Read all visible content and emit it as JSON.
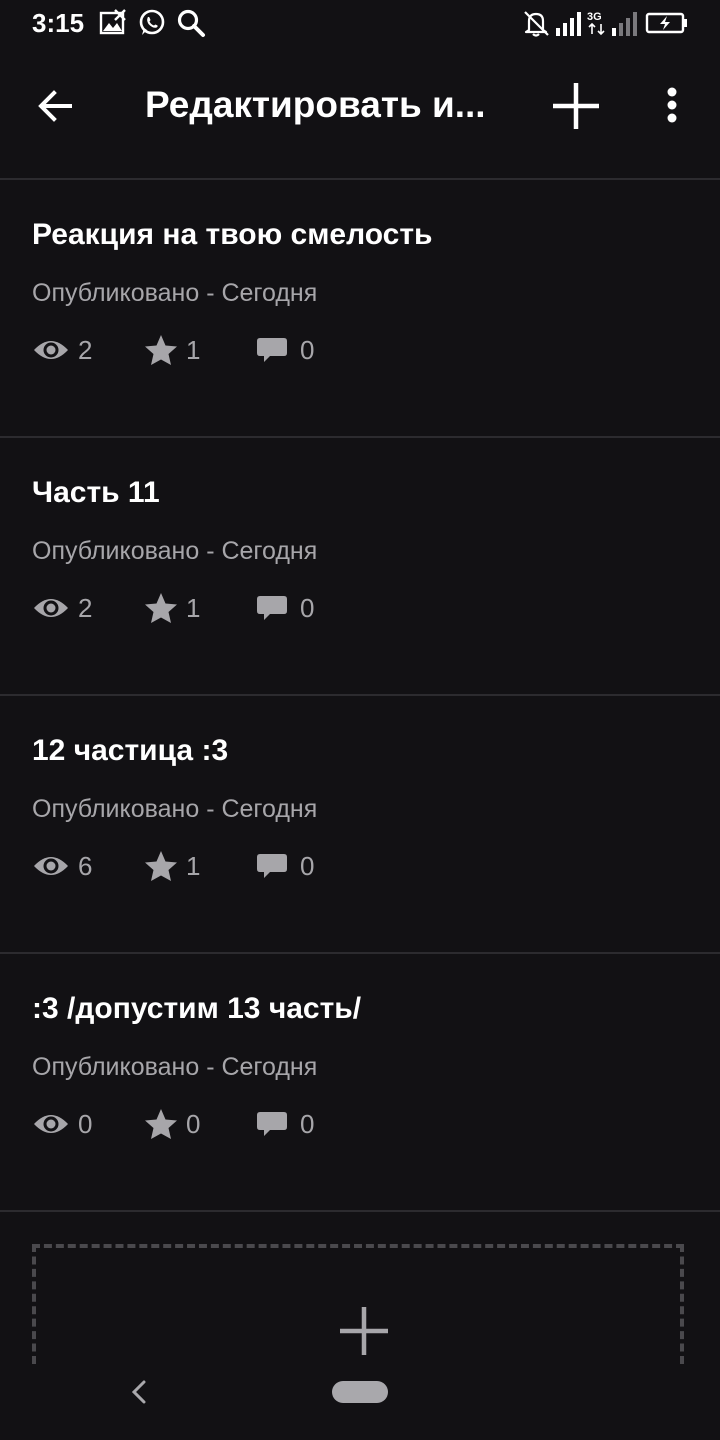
{
  "status_bar": {
    "time": "3:15",
    "icons": [
      "gallery-icon",
      "whatsapp-icon",
      "search-icon",
      "bell-off-icon",
      "signal-icon",
      "network-3g-icon",
      "signal-weak-icon",
      "battery-charging-icon"
    ],
    "network_label": "3G"
  },
  "app_bar": {
    "back_icon": "back-arrow-icon",
    "title": "Редактировать и...",
    "add_icon": "plus-icon",
    "more_icon": "more-vertical-icon"
  },
  "parts": [
    {
      "title": "Реакция на твою смелость",
      "status": "Опубликовано - Сегодня",
      "views": "2",
      "votes": "1",
      "comments": "0"
    },
    {
      "title": "Часть 11",
      "status": "Опубликовано - Сегодня",
      "views": "2",
      "votes": "1",
      "comments": "0"
    },
    {
      "title": "12 частица :3",
      "status": "Опубликовано - Сегодня",
      "views": "6",
      "votes": "1",
      "comments": "0"
    },
    {
      "title": ":3 /допустим 13 часть/",
      "status": "Опубликовано - Сегодня",
      "views": "0",
      "votes": "0",
      "comments": "0"
    }
  ],
  "add_part": {
    "icon": "plus-icon"
  },
  "nav_bar": {
    "back_icon": "nav-back-icon",
    "home_icon": "nav-home-pill"
  },
  "colors": {
    "background": "#121114",
    "divider": "#2c2b2f",
    "text_primary": "#ffffff",
    "text_secondary": "#a7a6aa",
    "icon_muted": "#a7a6aa"
  }
}
